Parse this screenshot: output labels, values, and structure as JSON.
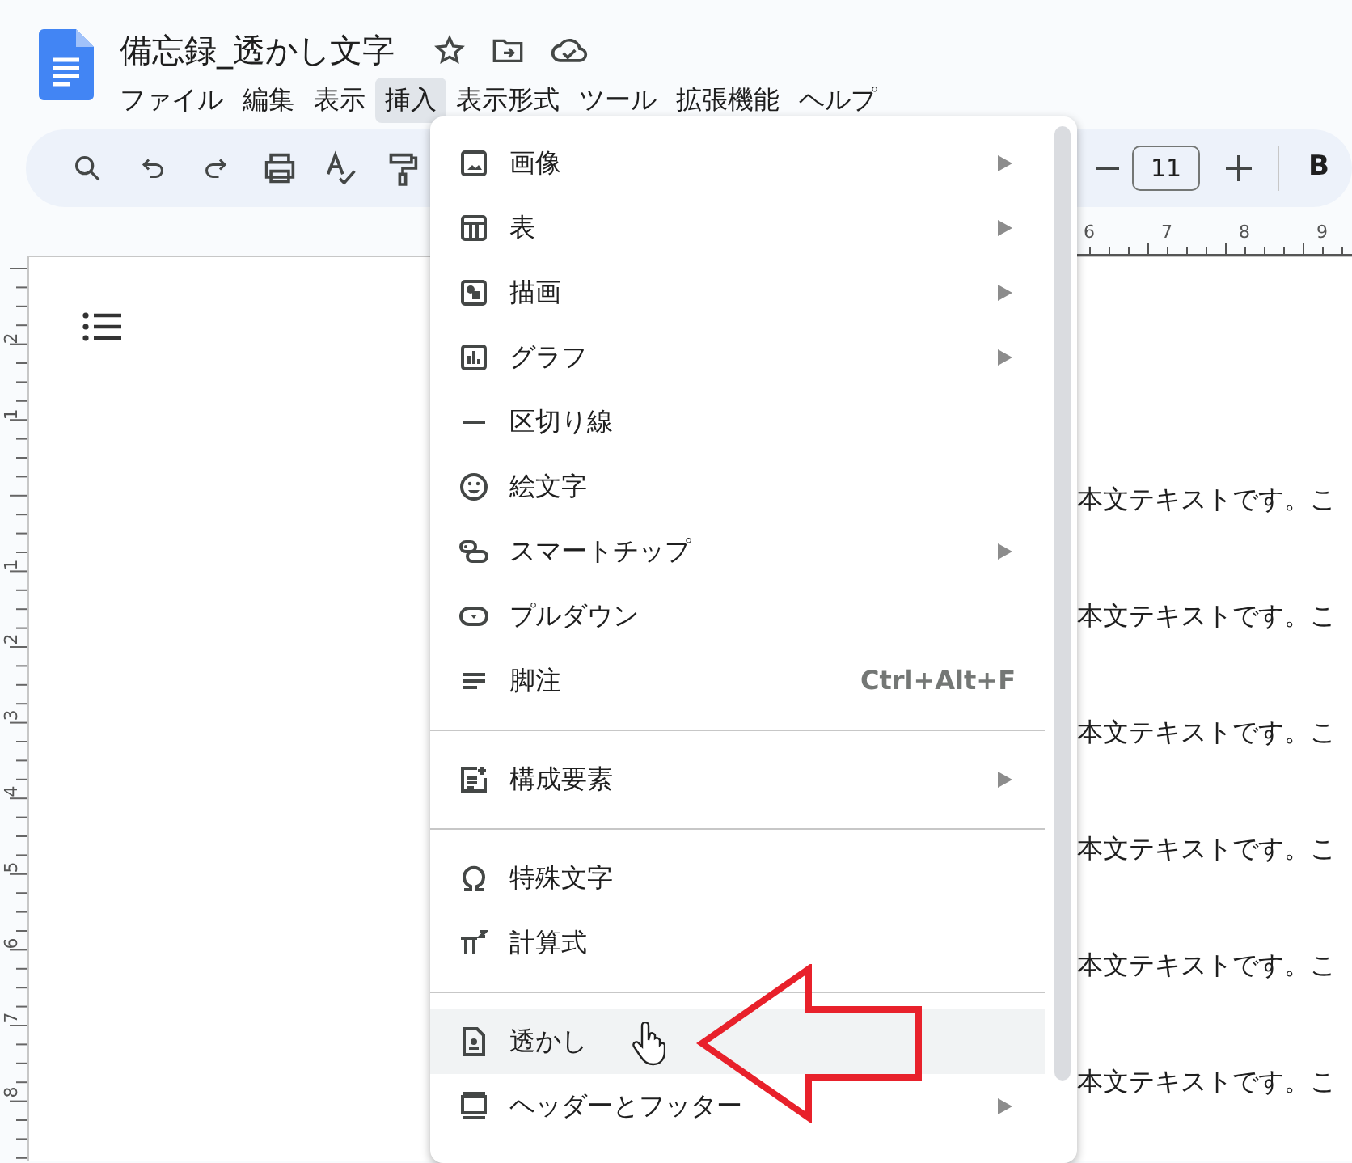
{
  "document": {
    "title": "備忘録_透かし文字"
  },
  "menubar": [
    {
      "label": "ファイル",
      "selected": false
    },
    {
      "label": "編集",
      "selected": false
    },
    {
      "label": "表示",
      "selected": false
    },
    {
      "label": "挿入",
      "selected": true
    },
    {
      "label": "表示形式",
      "selected": false
    },
    {
      "label": "ツール",
      "selected": false
    },
    {
      "label": "拡張機能",
      "selected": false
    },
    {
      "label": "ヘルプ",
      "selected": false
    }
  ],
  "toolbar": {
    "font_size": "11",
    "bold_label": "B"
  },
  "ruler": {
    "top_numbers": [
      "6",
      "7",
      "8",
      "9"
    ],
    "side_numbers": [
      "2",
      "1",
      "1",
      "2",
      "3",
      "4",
      "5",
      "6",
      "7",
      "8"
    ]
  },
  "insert_menu": {
    "items": [
      {
        "kind": "item",
        "label": "画像",
        "submenu": true,
        "selected": false
      },
      {
        "kind": "item",
        "label": "表",
        "submenu": true,
        "selected": false
      },
      {
        "kind": "item",
        "label": "描画",
        "submenu": true,
        "selected": false
      },
      {
        "kind": "item",
        "label": "グラフ",
        "submenu": true,
        "selected": false
      },
      {
        "kind": "item",
        "label": "区切り線",
        "submenu": false,
        "selected": false
      },
      {
        "kind": "item",
        "label": "絵文字",
        "submenu": false,
        "selected": false
      },
      {
        "kind": "item",
        "label": "スマートチップ",
        "submenu": true,
        "selected": false
      },
      {
        "kind": "item",
        "label": "プルダウン",
        "submenu": false,
        "selected": false
      },
      {
        "kind": "item",
        "label": "脚注",
        "submenu": false,
        "selected": false,
        "shortcut": "Ctrl+Alt+F"
      },
      {
        "kind": "divider"
      },
      {
        "kind": "item",
        "label": "構成要素",
        "submenu": true,
        "selected": false
      },
      {
        "kind": "divider"
      },
      {
        "kind": "item",
        "label": "特殊文字",
        "submenu": false,
        "selected": false
      },
      {
        "kind": "item",
        "label": "計算式",
        "submenu": false,
        "selected": false
      },
      {
        "kind": "divider"
      },
      {
        "kind": "item",
        "label": "透かし",
        "submenu": false,
        "selected": true
      },
      {
        "kind": "item",
        "label": "ヘッダーとフッター",
        "submenu": true,
        "selected": false
      }
    ]
  },
  "body_lines": [
    "本文テキストです。こ",
    "本文テキストです。こ",
    "本文テキストです。こ",
    "本文テキストです。こ",
    "本文テキストです。こ",
    "本文テキストです。こ"
  ]
}
